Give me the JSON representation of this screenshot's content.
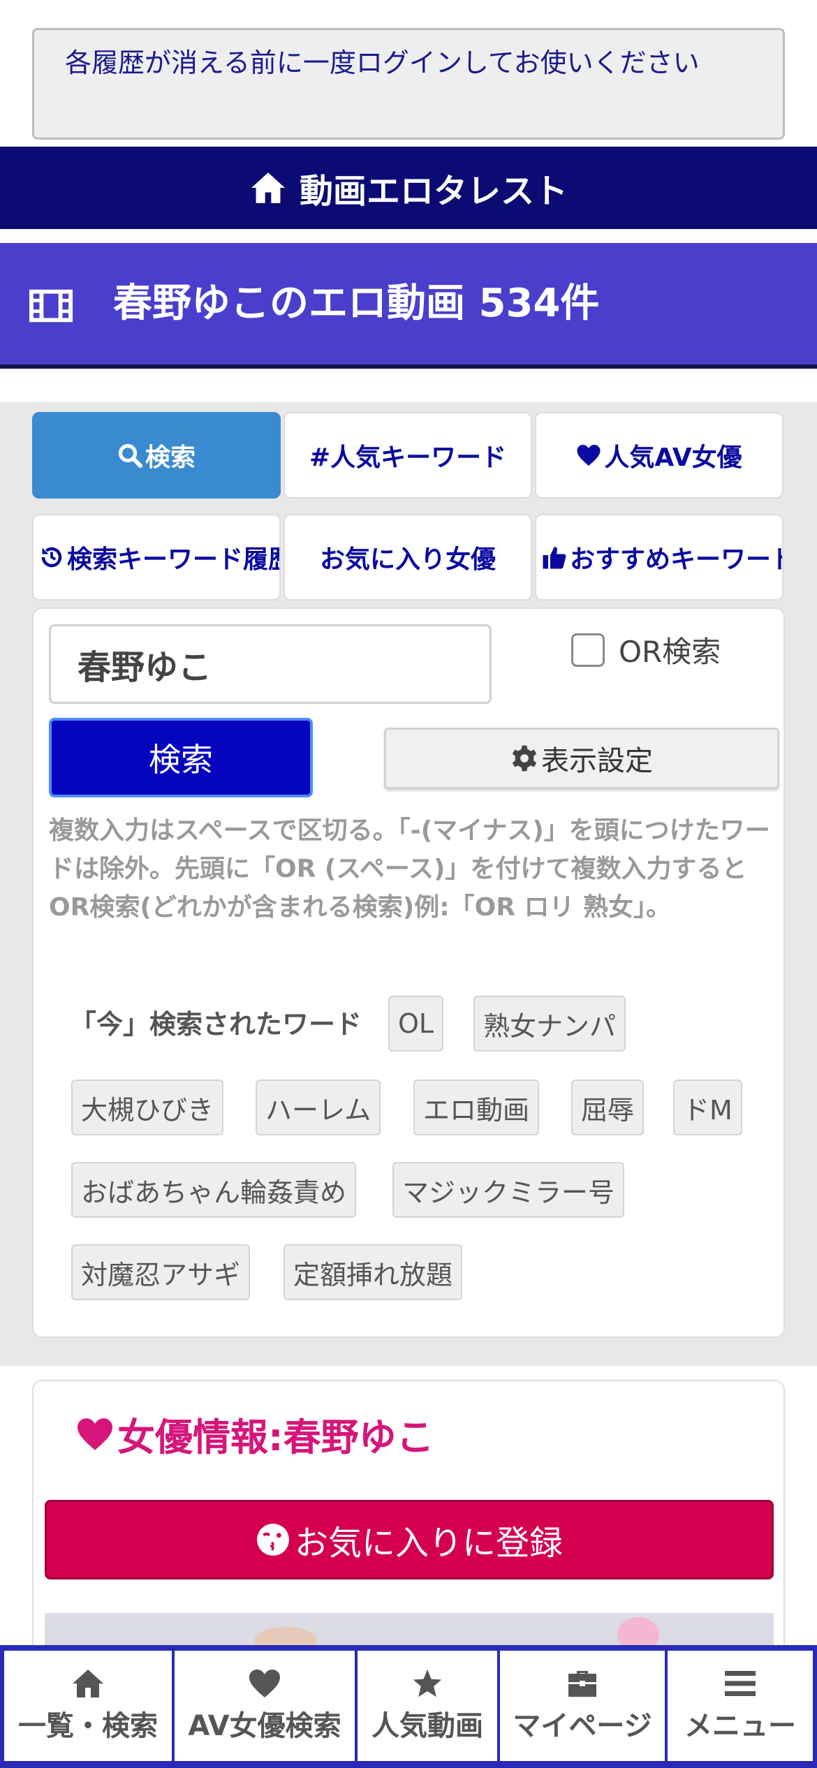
{
  "notice": {
    "text": "各履歴が消える前に一度ログインしてお使いください"
  },
  "site": {
    "title": "動画エロタレスト",
    "icon": "home-icon"
  },
  "page": {
    "title": "春野ゆこのエロ動画 534件",
    "icon": "film-icon"
  },
  "tabs": [
    {
      "label": "検索",
      "icon": "search-icon",
      "active": true
    },
    {
      "label": "#人気キーワード",
      "icon": "",
      "active": false
    },
    {
      "label": "人気AV女優",
      "icon": "heart-icon",
      "active": false
    },
    {
      "label": "検索キーワード履歴",
      "icon": "history-icon",
      "active": false
    },
    {
      "label": "お気に入り女優",
      "icon": "",
      "active": false
    },
    {
      "label": "おすすめキーワード",
      "icon": "thumbs-up-icon",
      "active": false
    }
  ],
  "search": {
    "value": "春野ゆこ",
    "or_label": "OR検索",
    "or_checked": false,
    "submit_label": "検索",
    "display_settings_label": "表示設定",
    "help": "複数入力はスペースで区切る。「-(マイナス)」を頭につけたワードは除外。先頭に「OR (スペース)」を付けて複数入力するとOR検索(どれかが含まれる検索)例:「OR ロリ 熟女」。"
  },
  "recent": {
    "label": "「今」検索されたワード",
    "words": [
      "OL",
      "熟女ナンパ",
      "大槻ひびき",
      "ハーレム",
      "エロ動画",
      "屈辱",
      "ドM",
      "おばあちゃん輪姦責め",
      "マジックミラー号",
      "対魔忍アサギ",
      "定額挿れ放題"
    ]
  },
  "actress": {
    "title": "女優情報:春野ゆこ",
    "favorite_label": "お気に入りに登録",
    "title_color": "#d6157a",
    "button_color": "#d4004f"
  },
  "bottom_nav": [
    {
      "label": "一覧・検索",
      "icon": "home-icon"
    },
    {
      "label": "AV女優検索",
      "icon": "heart-icon"
    },
    {
      "label": "人気動画",
      "icon": "star-icon"
    },
    {
      "label": "マイページ",
      "icon": "briefcase-icon"
    },
    {
      "label": "メニュー",
      "icon": "menu-icon"
    }
  ],
  "colors": {
    "header": "#0b0b73",
    "title_bar": "#4a3fcc",
    "active_tab": "#3a8ad0",
    "search_button": "#0505c0",
    "nav_border": "#2a2ab8"
  }
}
